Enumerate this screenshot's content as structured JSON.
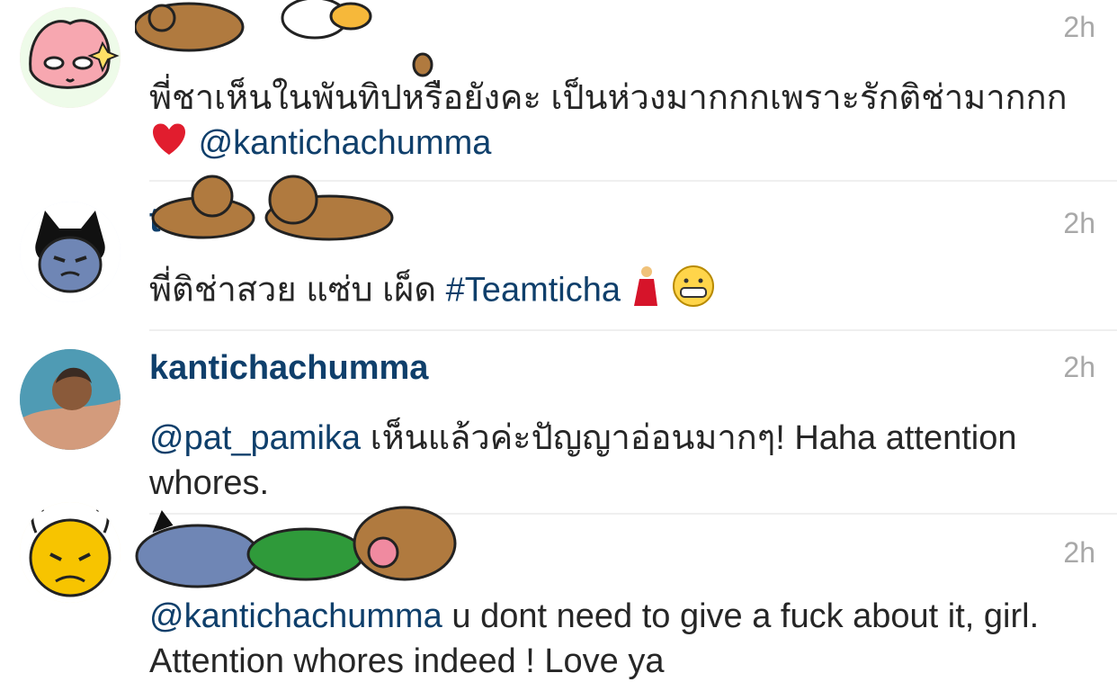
{
  "comments": [
    {
      "username": "",
      "time": "2h",
      "text": "พี่ชาเห็นในพันทิปหรือยังคะ เป็นห่วงมากกกเพราะรักติช่ามากกก",
      "mention": "@kantichachumma",
      "emoji_icon": "heart-icon"
    },
    {
      "username": "to",
      "time": "2h",
      "text": "พี่ติช่าสวย แซ่บ เผ็ด",
      "hashtag": "#Teamticha",
      "emoji_icons": [
        "dancer-icon",
        "grin-icon"
      ]
    },
    {
      "username": "kantichachumma",
      "time": "2h",
      "mention": "@pat_pamika",
      "text": "เห็นแล้วค่ะปัญญาอ่อนมากๆ! Haha attention whores."
    },
    {
      "username": "",
      "time": "2h",
      "mention": "@kantichachumma",
      "text": "u dont need to give a fuck about it, girl. Attention whores indeed ! Love ya"
    }
  ],
  "colors": {
    "link": "#0f3f6b",
    "meta": "#a8a8a8",
    "text": "#262626",
    "divider": "#efefef"
  }
}
